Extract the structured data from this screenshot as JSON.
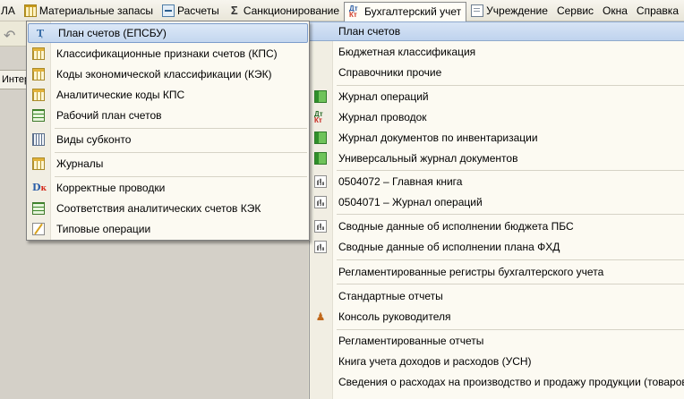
{
  "menubar": {
    "items": [
      {
        "label": "ЛА",
        "icon": ""
      },
      {
        "label": "Материальные запасы",
        "icon": "table-icon"
      },
      {
        "label": "Расчеты",
        "icon": "calc-icon"
      },
      {
        "label": "Санкционирование",
        "icon": "sigma-icon"
      },
      {
        "label": "Бухгалтерский учет",
        "icon": "dt-kt-icon",
        "active": true
      },
      {
        "label": "Учреждение",
        "icon": "document-icon"
      },
      {
        "label": "Сервис",
        "icon": ""
      },
      {
        "label": "Окна",
        "icon": ""
      },
      {
        "label": "Справка",
        "icon": ""
      }
    ]
  },
  "background": {
    "tab_label": "Интерфейс"
  },
  "accounting_menu": {
    "items": [
      {
        "label": "План счетов",
        "icon": "",
        "highlighted": true
      },
      {
        "label": "Бюджетная классификация",
        "icon": ""
      },
      {
        "label": "Справочники прочие",
        "icon": ""
      },
      {
        "label": "Журнал операций",
        "icon": "green-journal-icon"
      },
      {
        "label": "Журнал проводок",
        "icon": "dt-kt-icon"
      },
      {
        "label": "Журнал документов по инвентаризации",
        "icon": "green-journal-icon"
      },
      {
        "label": "Универсальный журнал документов",
        "icon": "green-journal-icon"
      },
      {
        "label": "0504072  –  Главная книга",
        "icon": "report-icon"
      },
      {
        "label": "0504071  –  Журнал операций",
        "icon": "report-icon"
      },
      {
        "label": "Сводные данные об исполнении бюджета ПБС",
        "icon": "report-icon"
      },
      {
        "label": "Сводные данные об исполнении плана ФХД",
        "icon": "report-icon"
      },
      {
        "label": "Регламентированные регистры бухгалтерского учета",
        "icon": ""
      },
      {
        "label": "Стандартные отчеты",
        "icon": ""
      },
      {
        "label": "Консоль руководителя",
        "icon": "manager-console-icon"
      },
      {
        "label": "Регламентированные отчеты",
        "icon": ""
      },
      {
        "label": "Книга учета доходов и расходов (УСН)",
        "icon": ""
      },
      {
        "label": "Сведения о расходах на производство и продажу продукции (товаров, работ",
        "icon": ""
      }
    ]
  },
  "chart_of_accounts_submenu": {
    "items": [
      {
        "label": "План счетов (ЕПСБУ)",
        "icon": "chart-of-accounts-icon",
        "highlighted": true
      },
      {
        "label": "Классификационные признаки счетов (КПС)",
        "icon": "table-icon"
      },
      {
        "label": "Коды экономической классификации (КЭК)",
        "icon": "table-icon"
      },
      {
        "label": "Аналитические коды КПС",
        "icon": "table-icon"
      },
      {
        "label": "Рабочий план счетов",
        "icon": "green-table-icon"
      },
      {
        "label": "Виды субконто",
        "icon": "view-grid-icon"
      },
      {
        "label": "Журналы",
        "icon": "table-icon"
      },
      {
        "label": "Корректные проводки",
        "icon": "dk-icon"
      },
      {
        "label": "Соответствия аналитических счетов КЭК",
        "icon": "green-table-icon"
      },
      {
        "label": "Типовые операции",
        "icon": "wand-icon"
      }
    ]
  }
}
